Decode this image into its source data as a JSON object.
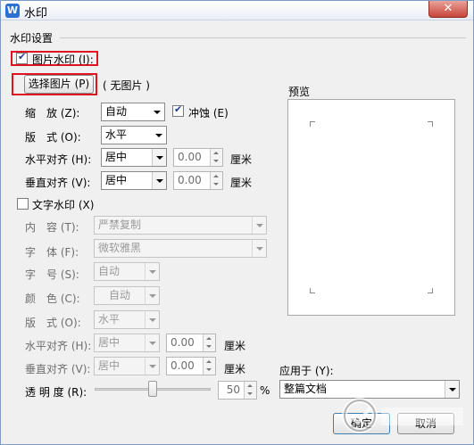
{
  "window": {
    "title": "水印",
    "close_glyph": "✕",
    "app_icon": "W"
  },
  "section": {
    "label": "水印设置"
  },
  "picture_watermark": {
    "checkbox_label": "图片水印 (I):",
    "checked": true,
    "choose_button": "选择图片 (P)",
    "status": "( 无图片 )",
    "scale_label": "缩　放 (Z):",
    "scale_value": "自动",
    "washout_label": "冲蚀 (E)",
    "washout_checked": true,
    "layout_label": "版　式 (O):",
    "layout_value": "水平",
    "halign_label": "水平对齐 (H):",
    "halign_value": "居中",
    "halign_offset": "0.00",
    "valign_label": "垂直对齐 (V):",
    "valign_value": "居中",
    "valign_offset": "0.00",
    "unit": "厘米"
  },
  "text_watermark": {
    "checkbox_label": "文字水印 (X)",
    "checked": false,
    "content_label": "内　容 (T):",
    "content_value": "严禁复制",
    "font_label": "字　体 (F):",
    "font_value": "微软雅黑",
    "size_label": "字　号 (S):",
    "size_value": "自动",
    "color_label": "颜　色 (C):",
    "color_value": "自动",
    "layout_label": "版　式 (O):",
    "layout_value": "水平",
    "halign_label": "水平对齐 (H):",
    "halign_value": "居中",
    "halign_offset": "0.00",
    "valign_label": "垂直对齐 (V):",
    "valign_value": "居中",
    "valign_offset": "0.00",
    "unit": "厘米",
    "transparency_label": "透 明 度 (R):",
    "transparency_value": "50",
    "transparency_unit": "%"
  },
  "preview": {
    "label": "预览"
  },
  "apply_to": {
    "label": "应用于 (Y):",
    "value": "整篇文档"
  },
  "buttons": {
    "ok": "确定",
    "cancel": "取消"
  },
  "colors": {
    "highlight": "#e0141e",
    "title_gradient_end": "#e9eef6"
  }
}
